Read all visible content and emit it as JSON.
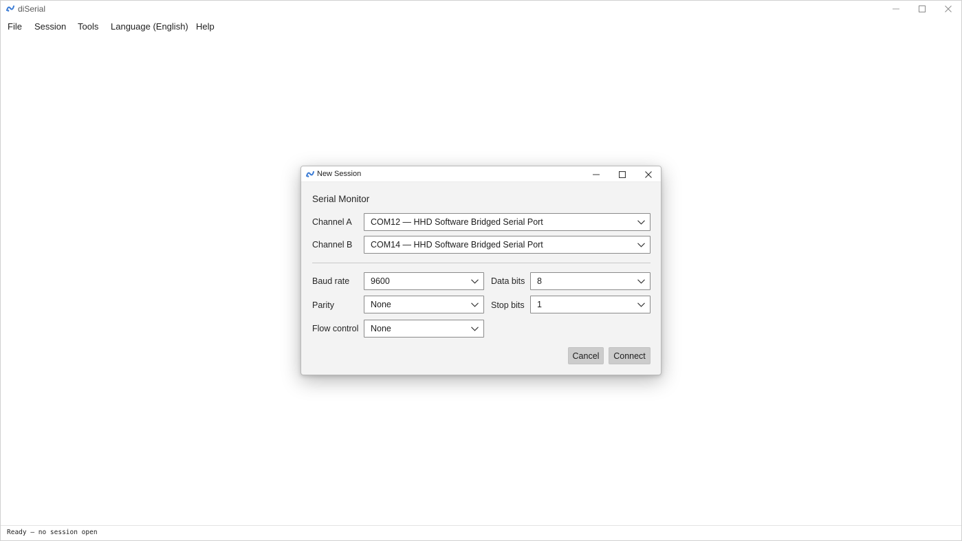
{
  "window": {
    "title": "diSerial",
    "icon": "diserial-logo-icon",
    "controls": [
      "minimize-icon",
      "maximize-icon",
      "close-icon"
    ]
  },
  "menubar": {
    "items": [
      {
        "label": "File"
      },
      {
        "label": "Session"
      },
      {
        "label": "Tools"
      },
      {
        "label": "Language (English)"
      },
      {
        "label": "Help"
      }
    ]
  },
  "dialog": {
    "title": "New Session",
    "icon": "diserial-logo-icon",
    "heading": "Serial Monitor",
    "channel_a": {
      "label": "Channel A",
      "value": "COM12 — HHD Software Bridged Serial Port"
    },
    "channel_b": {
      "label": "Channel B",
      "value": "COM14 — HHD Software Bridged Serial Port"
    },
    "baud_rate": {
      "label": "Baud rate",
      "value": "9600"
    },
    "data_bits": {
      "label": "Data bits",
      "value": "8"
    },
    "parity": {
      "label": "Parity",
      "value": "None"
    },
    "stop_bits": {
      "label": "Stop bits",
      "value": "1"
    },
    "flow_control": {
      "label": "Flow control",
      "value": "None"
    },
    "cancel_label": "Cancel",
    "connect_label": "Connect"
  },
  "statusbar": {
    "text": "Ready — no session open"
  },
  "colors": {
    "accent": "#3a7bd5",
    "button_bg": "#cccccc",
    "dialog_bg": "#f3f3f3"
  }
}
